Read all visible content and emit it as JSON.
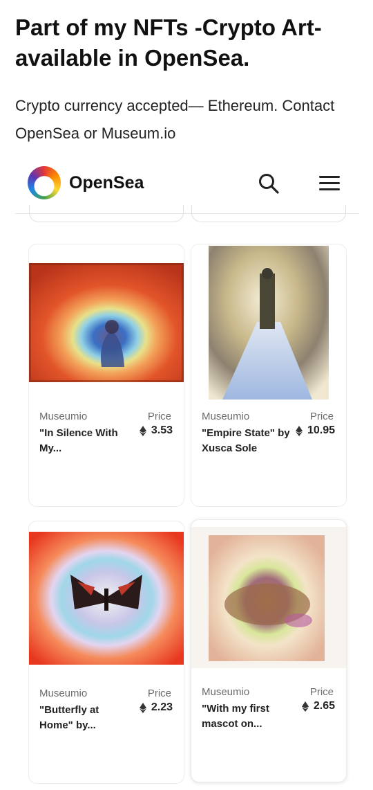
{
  "heading": "Part of my NFTs -Crypto Art- available in OpenSea.",
  "subtitle": "Crypto currency accepted— Ethereum. Contact OpenSea or Museum.io",
  "header": {
    "brand": "OpenSea",
    "logo_icon": "opensea-boat-icon",
    "search_icon": "search-icon",
    "menu_icon": "hamburger-menu-icon"
  },
  "colors": {
    "text": "#111111",
    "muted": "#6b6b6b",
    "divider": "#e5e5e5"
  },
  "cards": [
    {
      "creator": "Museumio",
      "price_label": "Price",
      "price": "3.53",
      "name": "\"In Silence With My...",
      "currency_icon": "ethereum-icon"
    },
    {
      "creator": "Museumio",
      "price_label": "Price",
      "price": "10.95",
      "name": "\"Empire State\" by Xusca Sole",
      "currency_icon": "ethereum-icon"
    },
    {
      "creator": "Museumio",
      "price_label": "Price",
      "price": "2.23",
      "name": "\"Butterfly at Home\" by...",
      "currency_icon": "ethereum-icon"
    },
    {
      "creator": "Museumio",
      "price_label": "Price",
      "price": "2.65",
      "name": "\"With my first mascot on...",
      "currency_icon": "ethereum-icon"
    }
  ]
}
